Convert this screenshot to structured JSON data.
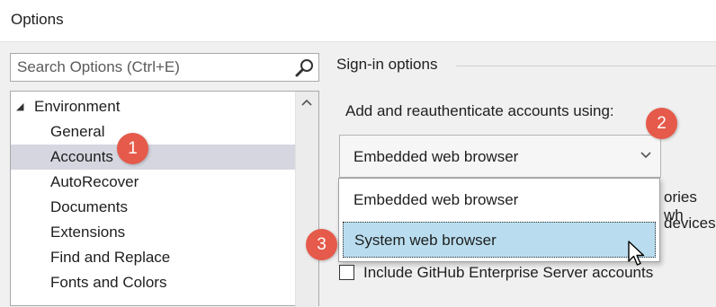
{
  "window": {
    "title": "Options"
  },
  "search": {
    "placeholder": "Search Options (Ctrl+E)",
    "icon": "search-icon"
  },
  "tree": {
    "root": {
      "label": "Environment",
      "expanded": true
    },
    "items": [
      {
        "label": "General",
        "selected": false
      },
      {
        "label": "Accounts",
        "selected": true
      },
      {
        "label": "AutoRecover",
        "selected": false
      },
      {
        "label": "Documents",
        "selected": false
      },
      {
        "label": "Extensions",
        "selected": false
      },
      {
        "label": "Find and Replace",
        "selected": false
      },
      {
        "label": "Fonts and Colors",
        "selected": false
      }
    ]
  },
  "content": {
    "group_label": "Sign-in options",
    "instruction": "Add and reauthenticate accounts using:",
    "combo_value": "Embedded web browser",
    "dropdown_options": [
      "Embedded web browser",
      "System web browser"
    ],
    "dropdown_highlighted_index": 1,
    "obscured_text_1": "ories wh",
    "obscured_text_2": "devices",
    "checkbox_label": "Include GitHub Enterprise Server accounts",
    "checkbox_checked": false
  },
  "badges": [
    "1",
    "2",
    "3"
  ],
  "colors": {
    "selection": "#d6d6e0",
    "dropdown_highlight": "#b9ddef",
    "badge": "#e55a4a"
  }
}
